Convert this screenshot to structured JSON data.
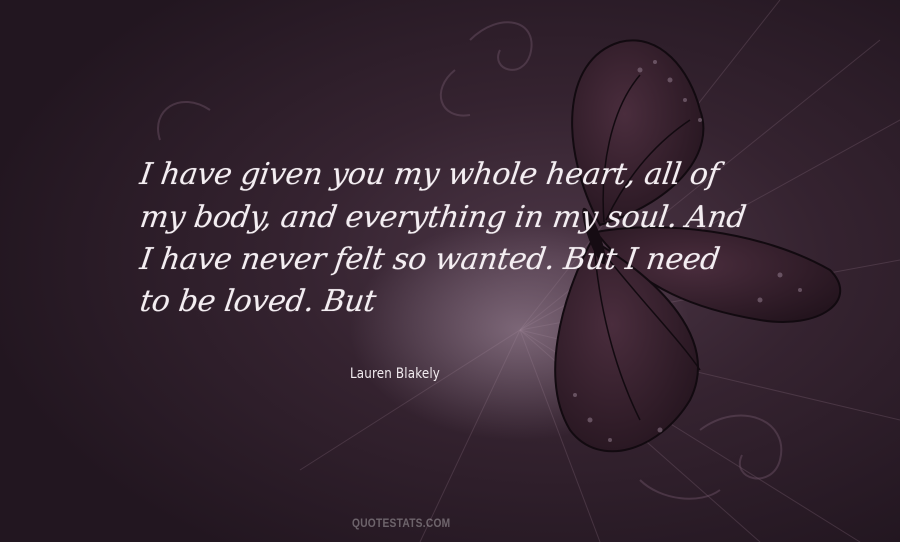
{
  "quote": {
    "lines": [
      "I have given you my whole heart, all of",
      "my body, and everything in my soul. And",
      "I have never felt so wanted. But I need",
      "to be loved.  But"
    ]
  },
  "author": "Lauren Blakely",
  "watermark": "QUOTESTATS.COM",
  "colors": {
    "background": "#2a1a25",
    "butterfly": "#3a2230",
    "text": "#f4eef2"
  },
  "icons": [
    "butterfly-illustration",
    "swirl-ornament"
  ]
}
